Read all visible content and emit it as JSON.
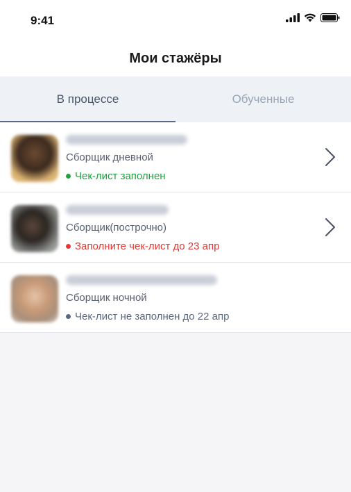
{
  "status_bar": {
    "time": "9:41",
    "icons": [
      "signal-icon",
      "wifi-icon",
      "battery-icon"
    ]
  },
  "header": {
    "title": "Мои стажёры"
  },
  "tabs": [
    {
      "label": "В процессе",
      "active": true
    },
    {
      "label": "Обученные",
      "active": false
    }
  ],
  "colors": {
    "green": "#1fa23f",
    "red": "#e53935",
    "gray": "#5c6880",
    "accent": "#5c6b85"
  },
  "trainees": [
    {
      "role": "Сборщик дневной",
      "status": "Чек-лист заполнен",
      "status_color": "#1fa23f",
      "dot_color": "#1fa23f",
      "has_chevron": true
    },
    {
      "role": "Сборщик(построчно)",
      "status": "Заполните чек-лист до 23 апр",
      "status_color": "#e53935",
      "dot_color": "#e53935",
      "has_chevron": true
    },
    {
      "role": "Сборщик ночной",
      "status": "Чек-лист не заполнен до 22 апр",
      "status_color": "#5c6880",
      "dot_color": "#5c6880",
      "has_chevron": false
    }
  ]
}
